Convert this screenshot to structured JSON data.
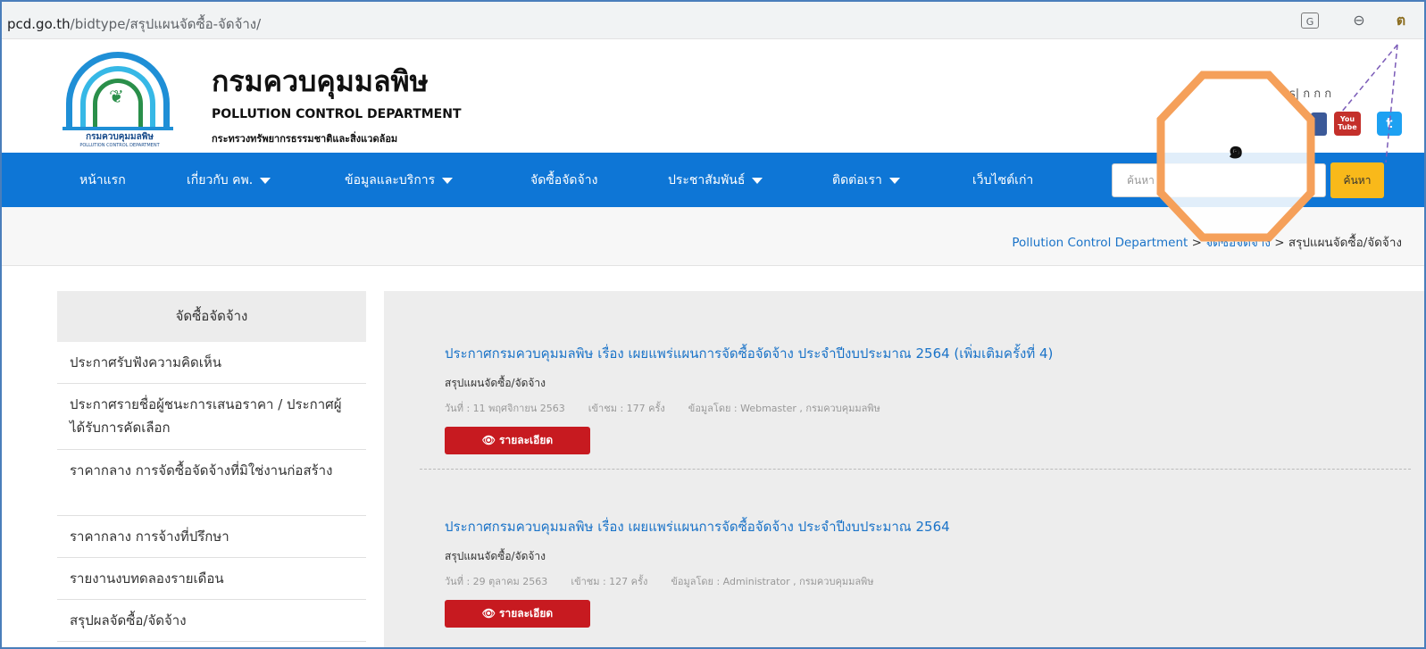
{
  "browser": {
    "url_host": "pcd.go.th",
    "url_path": "/bidtype/สรุปแผนจัดซื้อ-จัดจ้าง/",
    "translate_icon_glyph": "G",
    "zoom_icon_glyph": "⊖",
    "bookmark_icon_glyph": "ต"
  },
  "header": {
    "title_th": "กรมควบคุมมลพิษ",
    "title_en": "POLLUTION CONTROL DEPARTMENT",
    "ministry": "กระทรวงทรัพยากรธรรมชาติและสิ่งแวดล้อม",
    "logo_name_th": "กรมควบคุมมลพิษ",
    "logo_name_en": "POLLUTION CONTROL DEPARTMENT",
    "lang_links": "s| ก  ก  ก",
    "youtube_label": "You Tube",
    "twitter_glyph": "t"
  },
  "nav": {
    "items": [
      "หน้าแรก",
      "เกี่ยวกับ คพ.",
      "ข้อมูลและบริการ",
      "จัดซื้อจัดจ้าง",
      "ประชาสัมพันธ์",
      "ติดต่อเรา",
      "เว็บไซต์เก่า"
    ],
    "search_placeholder": "ค้นหา",
    "search_button": "ค้นหา"
  },
  "breadcrumb": {
    "home": "Pollution Control Department",
    "sep": " > ",
    "section": "จัดซื้อจัดจ้าง",
    "current": "สรุปแผนจัดซื้อ/จัดจ้าง"
  },
  "sidebar": {
    "heading": "จัดซื้อจัดจ้าง",
    "items": [
      "ประกาศรับฟังความคิดเห็น",
      "ประกาศรายชื่อผู้ชนะการเสนอราคา / ประกาศผู้ได้รับการคัดเลือก",
      "ราคากลาง การจัดซื้อจัดจ้างที่มิใช่งานก่อสร้าง",
      "ราคากลาง การจ้างที่ปรึกษา",
      "รายงานงบทดลองรายเดือน",
      "สรุปผลจัดซื้อ/จัดจ้าง"
    ]
  },
  "entries": [
    {
      "title": "ประกาศกรมควบคุมมลพิษ เรื่อง เผยแพร่แผนการจัดซื้อจัดจ้าง ประจำปีงบประมาณ 2564 (เพิ่มเติมครั้งที่ 4)",
      "category": "สรุปแผนจัดซื้อ/จัดจ้าง",
      "date": "วันที่ : 11 พฤศจิกายน 2563",
      "views": "เข้าชม : 177 ครั้ง",
      "author": "ข้อมูลโดย : Webmaster , กรมควบคุมมลพิษ",
      "button": "รายละเอียด"
    },
    {
      "title": "ประกาศกรมควบคุมมลพิษ เรื่อง เผยแพร่แผนการจัดซื้อจัดจ้าง ประจำปีงบประมาณ 2564",
      "category": "สรุปแผนจัดซื้อ/จัดจ้าง",
      "date": "วันที่ : 29 ตุลาคม 2563",
      "views": "เข้าชม : 127 ครั้ง",
      "author": "ข้อมูลโดย : Administrator , กรมควบคุมมลพิษ",
      "button": "รายละเอียด"
    }
  ],
  "annotation": {
    "label": "๑",
    "color": "#f5a05a",
    "line_color": "#7b5cb8"
  },
  "colors": {
    "nav_bg": "#0e76d6",
    "link": "#1a73c8",
    "detail_button": "#c71a20",
    "search_button": "#f9b91a"
  }
}
